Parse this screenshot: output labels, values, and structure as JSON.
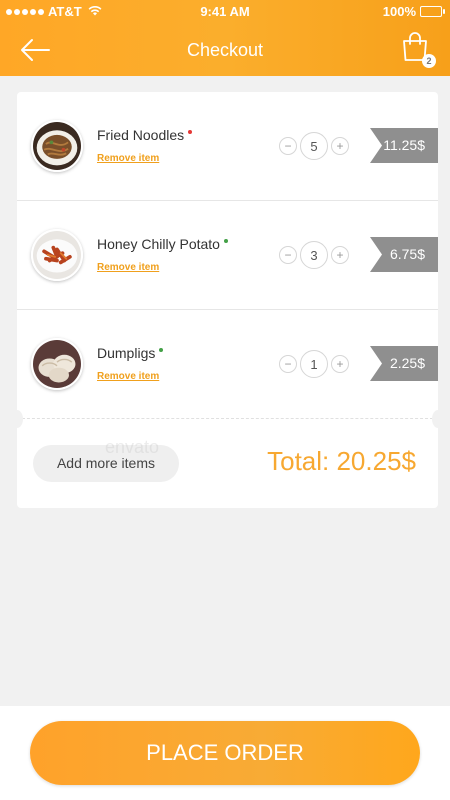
{
  "status_bar": {
    "carrier": "AT&T",
    "time": "9:41 AM",
    "battery": "100%",
    "battery_level": 1.0
  },
  "header": {
    "title": "Checkout",
    "back_icon": "arrow-left-icon",
    "cart_icon": "shopping-bag-icon",
    "cart_count": "2"
  },
  "cart": {
    "items": [
      {
        "name": "Fried Noodles",
        "remove_label": "Remove item",
        "quantity": "5",
        "price": "11.25$",
        "dot_color": "#e53935",
        "image": "fried-noodles"
      },
      {
        "name": "Honey Chilly Potato",
        "remove_label": "Remove item",
        "quantity": "3",
        "price": "6.75$",
        "dot_color": "#43a047",
        "image": "honey-chilly-potato"
      },
      {
        "name": "Dumpligs",
        "remove_label": "Remove item",
        "quantity": "1",
        "price": "2.25$",
        "dot_color": "#43a047",
        "image": "dumplings"
      }
    ],
    "stepper": {
      "minus": "−",
      "plus": "+"
    },
    "add_more_label": "Add more items",
    "total": "Total: 20.25$"
  },
  "watermark": "envato",
  "footer": {
    "place_order_label": "PLACE ORDER"
  },
  "colors": {
    "accent": "#f9a825",
    "price_tag": "#8f8f8f"
  }
}
